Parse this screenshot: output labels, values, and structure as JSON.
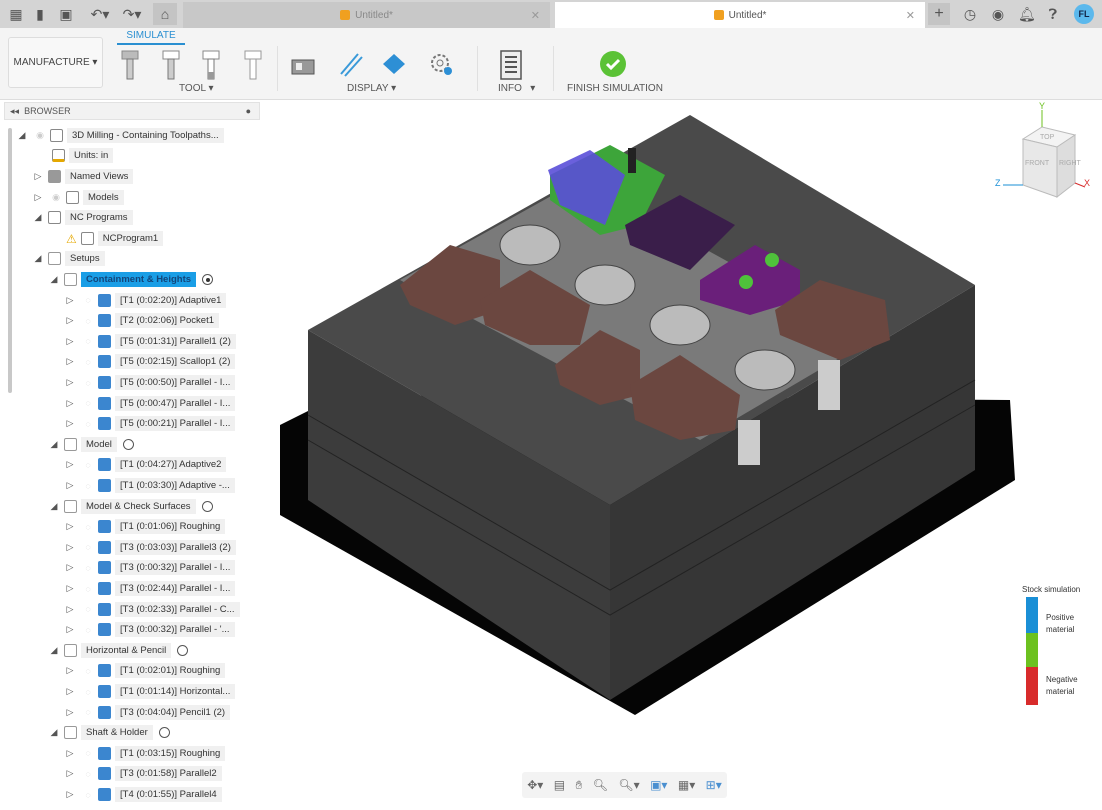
{
  "tabs": [
    {
      "label": "Untitled*",
      "active": false
    },
    {
      "label": "Untitled*",
      "active": true
    }
  ],
  "user": {
    "initials": "FL"
  },
  "toolbar": {
    "workspace": "MANUFACTURE",
    "tab": "SIMULATE",
    "groups": {
      "tool": "TOOL",
      "display": "DISPLAY",
      "info": "INFO",
      "finish": "FINISH SIMULATION"
    }
  },
  "browser": {
    "title": "BROWSER",
    "root": "3D Milling - Containing  Toolpaths...",
    "units": "Units: in",
    "named_views": "Named Views",
    "models": "Models",
    "nc_programs": "NC Programs",
    "nc_program1": "NCProgram1",
    "setups": "Setups",
    "setup_list": [
      {
        "name": "Containment & Heights",
        "selected": true,
        "ops": [
          "[T1 (0:02:20)] Adaptive1",
          "[T2 (0:02:06)] Pocket1",
          "[T5 (0:01:31)] Parallel1 (2)",
          "[T5 (0:02:15)] Scallop1 (2)",
          "[T5 (0:00:50)] Parallel - I...",
          "[T5 (0:00:47)] Parallel - I...",
          "[T5 (0:00:21)] Parallel - I..."
        ]
      },
      {
        "name": "Model",
        "selected": false,
        "ops": [
          "[T1 (0:04:27)] Adaptive2",
          "[T1 (0:03:30)] Adaptive -..."
        ]
      },
      {
        "name": "Model & Check Surfaces",
        "selected": false,
        "ops": [
          "[T1 (0:01:06)] Roughing",
          "[T3 (0:03:03)] Parallel3 (2)",
          "[T3 (0:00:32)] Parallel - I...",
          "[T3 (0:02:44)] Parallel - I...",
          "[T3 (0:02:33)] Parallel - C...",
          "[T3 (0:00:32)] Parallel - '..."
        ]
      },
      {
        "name": "Horizontal & Pencil",
        "selected": false,
        "ops": [
          "[T1 (0:02:01)] Roughing",
          "[T1 (0:01:14)] Horizontal...",
          "[T3 (0:04:04)] Pencil1 (2)"
        ]
      },
      {
        "name": "Shaft & Holder",
        "selected": false,
        "ops": [
          "[T1 (0:03:15)] Roughing",
          "[T3 (0:01:58)] Parallel2",
          "[T4 (0:01:55)] Parallel4"
        ]
      }
    ]
  },
  "viewcube": {
    "top": "TOP",
    "front": "FRONT",
    "right": "RIGHT",
    "x": "X",
    "y": "Y",
    "z": "Z"
  },
  "legend": {
    "title": "Stock simulation",
    "positive": "Positive material",
    "negative": "Negative material",
    "colors": {
      "positive": "#1a8fd6",
      "neutral": "#6cc11f",
      "negative": "#d82b2b"
    }
  }
}
